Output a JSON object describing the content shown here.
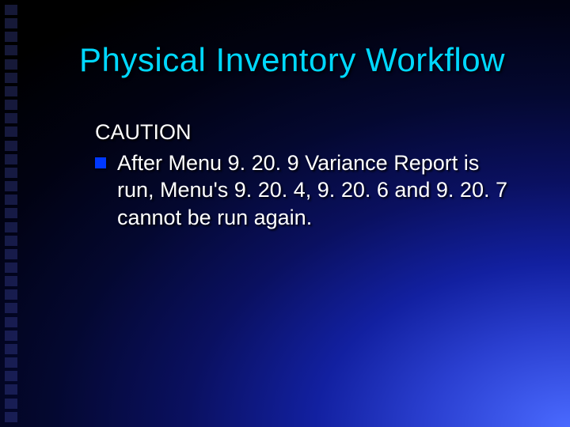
{
  "title": "Physical Inventory Workflow",
  "caution_label": "CAUTION",
  "bullets": [
    {
      "text": "After Menu 9. 20. 9 Variance Report is run, Menu's 9. 20. 4, 9. 20. 6 and 9. 20. 7 cannot be run again."
    }
  ],
  "decor": {
    "square_count": 31
  }
}
